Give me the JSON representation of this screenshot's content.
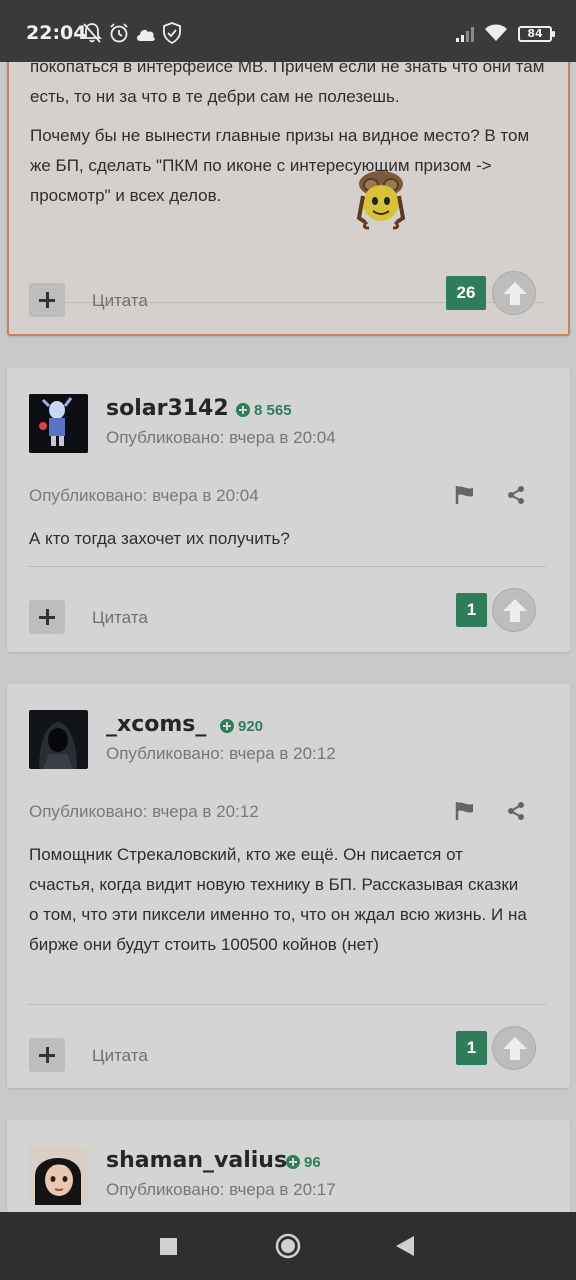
{
  "status_bar": {
    "time": "22:04",
    "battery": "84",
    "icons": [
      "bell-off-icon",
      "alarm-icon",
      "cloud-icon",
      "shield-check-icon",
      "signal-icon",
      "wifi-icon",
      "battery-icon"
    ]
  },
  "top_post": {
    "paragraphs": [
      "покопаться в интерфейсе МВ. Причем если не знать что они там есть, то ни за что в те дебри сам не полезешь.",
      "Почему бы не вынести главные призы на видное место? В том же БП, сделать \"ПКМ по иконе с интересующим призом -> просмотр\" и всех делов."
    ],
    "emoji": "aviator-smiley",
    "quote_label": "Цитата",
    "reputation": "26",
    "border_color": "#c9845d"
  },
  "posts": [
    {
      "username": "solar3142",
      "reputation": "8 565",
      "published_header": "Опубликовано: вчера в 20:04",
      "published": "Опубликовано: вчера в 20:04",
      "text": "А кто тогда захочет их получить?",
      "quote_label": "Цитата",
      "likes": "1"
    },
    {
      "username": "_xcoms_",
      "reputation": "920",
      "published_header": "Опубликовано: вчера в 20:12",
      "published": "Опубликовано: вчера в 20:12",
      "text": "Помощник Стрекаловский, кто же ещё. Он писается от счастья, когда видит новую технику в БП. Рассказывая сказки о том, что эти пиксели именно то, что он ждал всю жизнь. И на бирже они будут стоить 100500 койнов (нет)",
      "quote_label": "Цитата",
      "likes": "1"
    },
    {
      "username": "shaman_valius",
      "reputation": "96",
      "published_header": "Опубликовано: вчера в 20:17"
    }
  ],
  "colors": {
    "accent_green": "#2f7d5a",
    "card_bg": "#d4d4d4",
    "page_bg": "#c9c9c9",
    "status_bar_bg": "#3a3a3a",
    "nav_bar_bg": "#2f2f2f"
  },
  "nav_bar": {
    "buttons": [
      "recents-square-icon",
      "home-circle-icon",
      "back-triangle-icon"
    ]
  }
}
